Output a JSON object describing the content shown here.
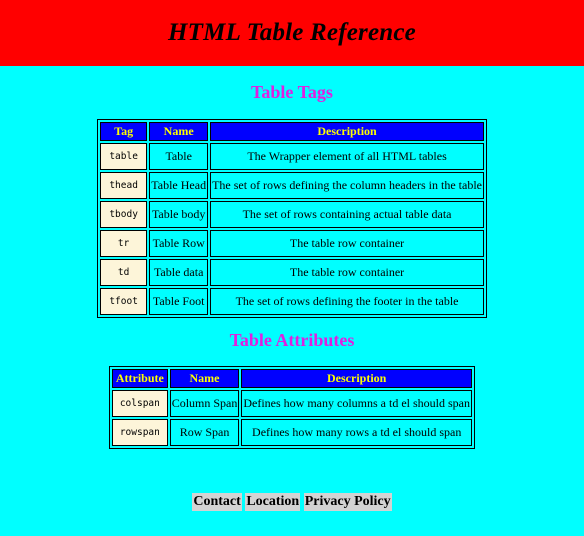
{
  "header": {
    "title": "HTML Table Reference"
  },
  "tags_section": {
    "title": "Table Tags",
    "columns": [
      "Tag",
      "Name",
      "Description"
    ],
    "rows": [
      {
        "tag": "table",
        "name": "Table",
        "description": "The Wrapper element of all HTML tables"
      },
      {
        "tag": "thead",
        "name": "Table Head",
        "description": "The set of rows defining the column headers in the table"
      },
      {
        "tag": "tbody",
        "name": "Table body",
        "description": "The set of rows containing actual table data"
      },
      {
        "tag": "tr",
        "name": "Table Row",
        "description": "The table row container"
      },
      {
        "tag": "td",
        "name": "Table data",
        "description": "The table row container"
      },
      {
        "tag": "tfoot",
        "name": "Table Foot",
        "description": "The set of rows defining the footer in the table"
      }
    ]
  },
  "attributes_section": {
    "title": "Table Attributes",
    "columns": [
      "Attribute",
      "Name",
      "Description"
    ],
    "rows": [
      {
        "attribute": "colspan",
        "name": "Column Span",
        "description": "Defines how many columns a td el should span"
      },
      {
        "attribute": "rowspan",
        "name": "Row Span",
        "description": "Defines how many rows a td el should span"
      }
    ]
  },
  "footer": {
    "links": [
      "Contact",
      "Location",
      "Privacy Policy"
    ]
  },
  "colors": {
    "page_background": "#00ffff",
    "banner_background": "#ff0000",
    "section_title": "#e020e0",
    "table_header_background": "#0000ff",
    "table_header_text": "#ffff00",
    "code_cell_background": "#fdf5d9",
    "footer_link_background": "#d3d3d3"
  }
}
